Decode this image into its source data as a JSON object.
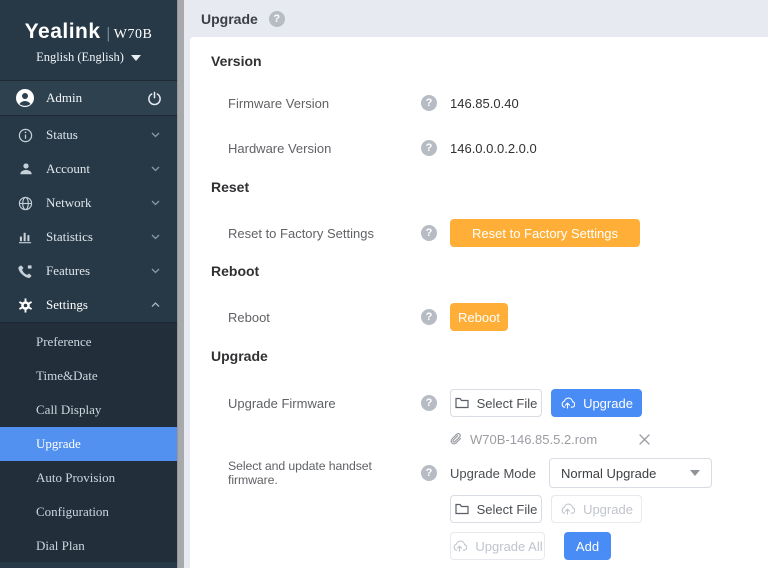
{
  "brand": {
    "logo": "Yealink",
    "model": "W70B",
    "language": "English (English)"
  },
  "user": {
    "name": "Admin"
  },
  "sidebar": {
    "items": [
      {
        "label": "Status",
        "icon": "info-icon",
        "state": "collapsed"
      },
      {
        "label": "Account",
        "icon": "user-icon",
        "state": "collapsed"
      },
      {
        "label": "Network",
        "icon": "globe-icon",
        "state": "collapsed"
      },
      {
        "label": "Statistics",
        "icon": "bar-chart-icon",
        "state": "collapsed"
      },
      {
        "label": "Features",
        "icon": "phone-icon",
        "state": "collapsed"
      },
      {
        "label": "Settings",
        "icon": "gear-icon",
        "state": "expanded"
      }
    ],
    "submenu": [
      "Preference",
      "Time&Date",
      "Call Display",
      "Upgrade",
      "Auto Provision",
      "Configuration",
      "Dial Plan"
    ],
    "active_submenu": "Upgrade"
  },
  "page": {
    "title": "Upgrade"
  },
  "version": {
    "heading": "Version",
    "firmware_label": "Firmware Version",
    "firmware_value": "146.85.0.40",
    "hardware_label": "Hardware Version",
    "hardware_value": "146.0.0.0.2.0.0"
  },
  "reset": {
    "heading": "Reset",
    "label": "Reset to Factory Settings",
    "button": "Reset to Factory Settings"
  },
  "reboot": {
    "heading": "Reboot",
    "label": "Reboot",
    "button": "Reboot"
  },
  "upgrade": {
    "heading": "Upgrade",
    "firmware_label": "Upgrade Firmware",
    "select_file_button": "Select File",
    "upgrade_button": "Upgrade",
    "file_name": "W70B-146.85.5.2.rom",
    "handset_label": "Select and update handset firmware.",
    "mode_label": "Upgrade Mode",
    "mode_value": "Normal Upgrade",
    "select_file2_button": "Select File",
    "upgrade2_button": "Upgrade",
    "upgrade_all_button": "Upgrade All",
    "add_button": "Add"
  },
  "colors": {
    "sidebar_bg": "#273946",
    "submenu_bg": "#222f3a",
    "active_blue": "#5291f0",
    "primary_blue": "#4a8cf5",
    "warning_orange": "#ffaf38",
    "header_bg": "#e7eaf1"
  }
}
